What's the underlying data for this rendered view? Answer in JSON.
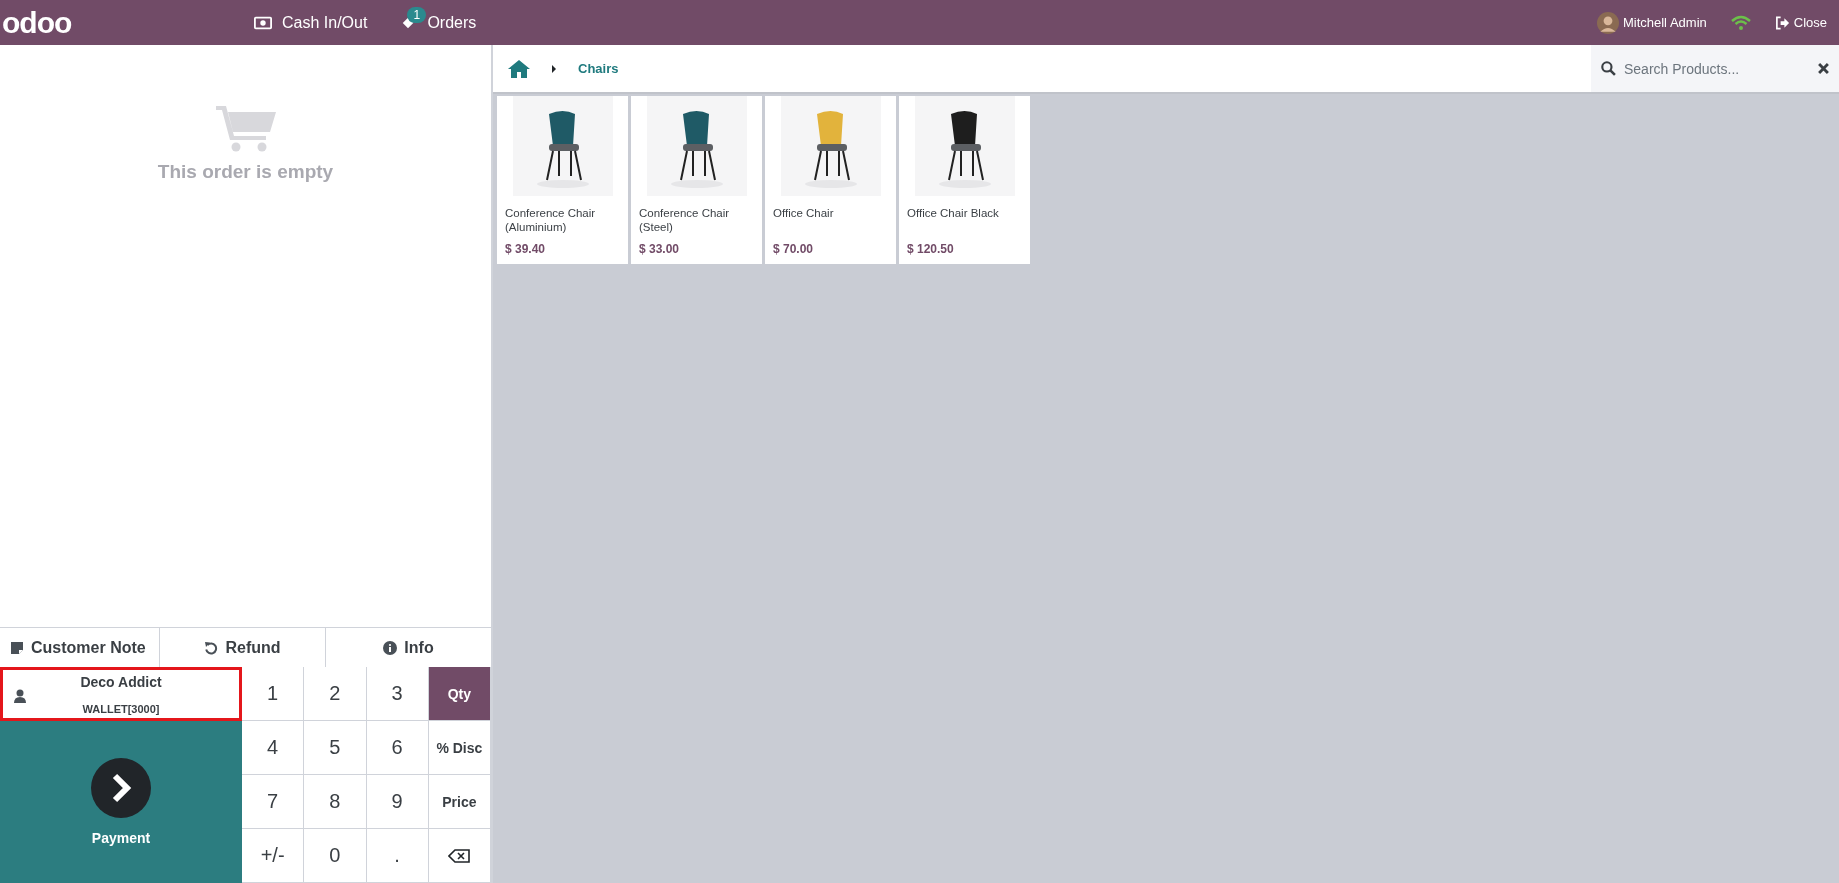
{
  "top_bar": {
    "logo": "odoo",
    "actions": [
      {
        "kind": "cash",
        "label": "Cash In/Out"
      },
      {
        "kind": "orders",
        "label": "Orders",
        "badge": "1"
      }
    ],
    "user": "Mitchell Admin",
    "close": "Close"
  },
  "order": {
    "empty_message": "This order is empty"
  },
  "control_buttons": [
    {
      "kind": "note",
      "label": "Customer Note"
    },
    {
      "kind": "refund",
      "label": "Refund"
    },
    {
      "kind": "info",
      "label": "Info"
    }
  ],
  "customer": {
    "name": "Deco Addict",
    "detail": "WALLET[3000]",
    "highlighted": true
  },
  "payment": {
    "label": "Payment"
  },
  "numpad": [
    {
      "kind": "digit",
      "label": "1"
    },
    {
      "kind": "digit",
      "label": "2"
    },
    {
      "kind": "digit",
      "label": "3"
    },
    {
      "kind": "mode",
      "label": "Qty",
      "selected": true
    },
    {
      "kind": "digit",
      "label": "4"
    },
    {
      "kind": "digit",
      "label": "5"
    },
    {
      "kind": "digit",
      "label": "6"
    },
    {
      "kind": "mode",
      "label": "% Disc",
      "selected": false
    },
    {
      "kind": "digit",
      "label": "7"
    },
    {
      "kind": "digit",
      "label": "8"
    },
    {
      "kind": "digit",
      "label": "9"
    },
    {
      "kind": "mode",
      "label": "Price",
      "selected": false
    },
    {
      "kind": "digit",
      "label": "+/-"
    },
    {
      "kind": "digit",
      "label": "0"
    },
    {
      "kind": "digit",
      "label": "."
    },
    {
      "kind": "backspace"
    }
  ],
  "breadcrumb": {
    "category": "Chairs"
  },
  "search": {
    "placeholder": "Search Products..."
  },
  "products": [
    {
      "name": "Conference Chair (Aluminium)",
      "price": "$ 39.40"
    },
    {
      "name": "Conference Chair (Steel)",
      "price": "$ 33.00"
    },
    {
      "name": "Office Chair",
      "price": "$ 70.00"
    },
    {
      "name": "Office Chair Black",
      "price": "$ 120.50"
    }
  ]
}
